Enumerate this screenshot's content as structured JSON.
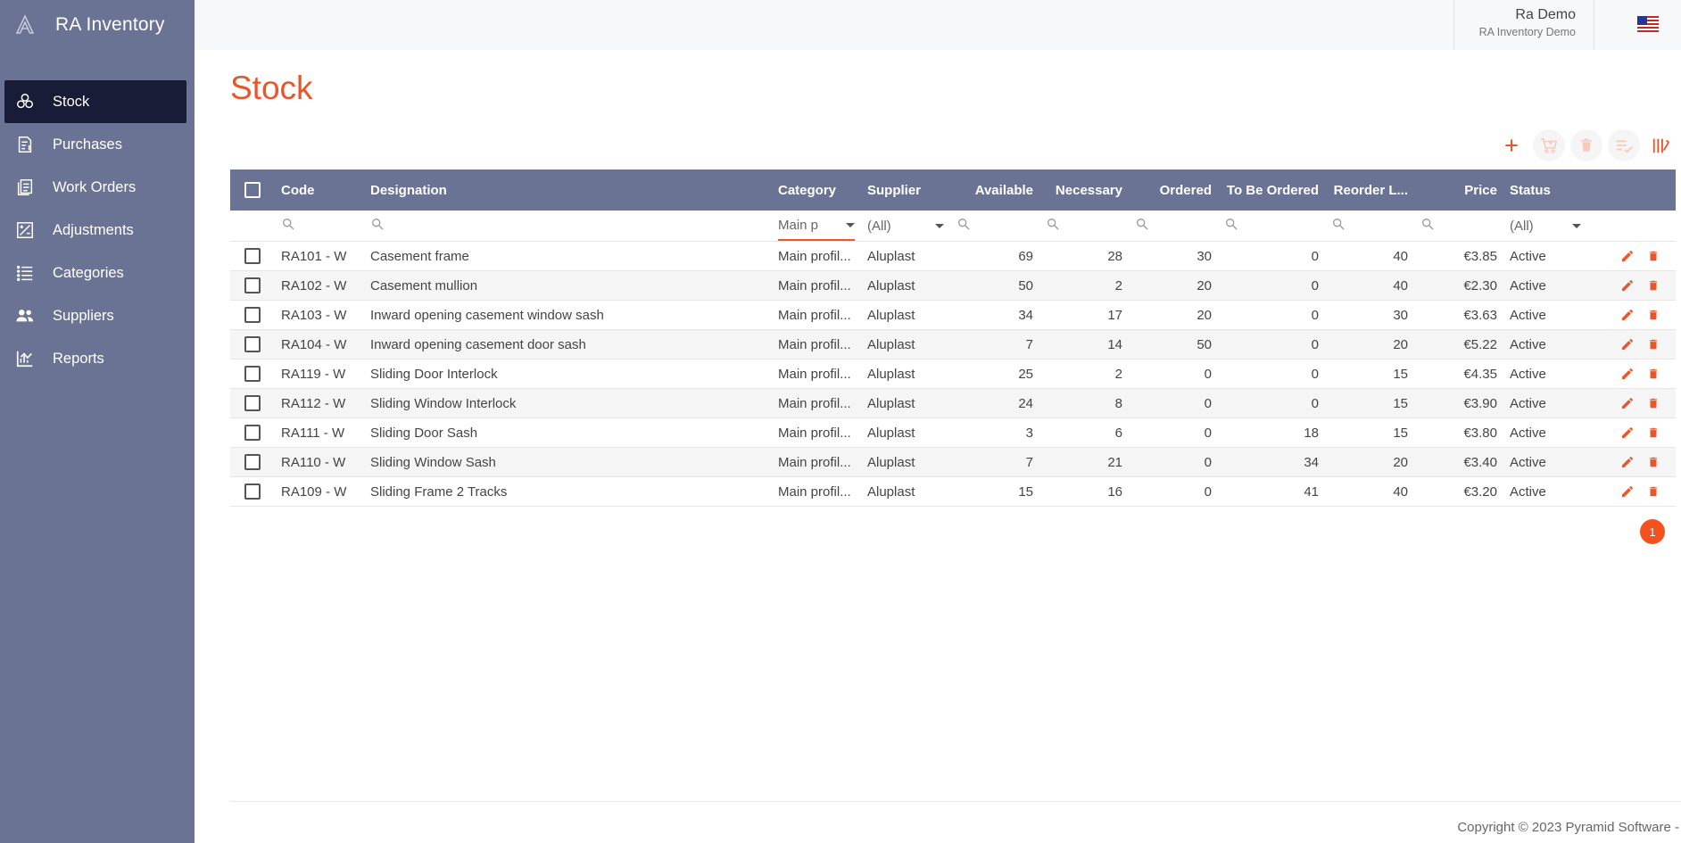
{
  "app": {
    "title": "RA Inventory"
  },
  "sidebar": {
    "items": [
      {
        "label": "Stock",
        "icon": "stock-icon",
        "active": true
      },
      {
        "label": "Purchases",
        "icon": "purchases-icon"
      },
      {
        "label": "Work Orders",
        "icon": "work-orders-icon"
      },
      {
        "label": "Adjustments",
        "icon": "adjustments-icon"
      },
      {
        "label": "Categories",
        "icon": "categories-icon"
      },
      {
        "label": "Suppliers",
        "icon": "suppliers-icon"
      },
      {
        "label": "Reports",
        "icon": "reports-icon"
      }
    ]
  },
  "header": {
    "user_name": "Ra Demo",
    "user_org": "RA Inventory Demo",
    "flag_icon": "us-flag-icon"
  },
  "page": {
    "title": "Stock"
  },
  "colors": {
    "accent": "#e8562a",
    "sidebar": "#6b7394",
    "sidebar_active": "#181c36"
  },
  "table": {
    "columns": {
      "code": "Code",
      "designation": "Designation",
      "category": "Category",
      "supplier": "Supplier",
      "available": "Available",
      "necessary": "Necessary",
      "ordered": "Ordered",
      "to_be_ordered": "To Be Ordered",
      "reorder_level": "Reorder L...",
      "price": "Price",
      "status": "Status"
    },
    "filters": {
      "category": "Main p",
      "supplier": "(All)",
      "status": "(All)"
    },
    "rows": [
      {
        "code": "RA101 - W",
        "designation": "Casement frame",
        "category": "Main profil...",
        "supplier": "Aluplast",
        "available": "69",
        "necessary": "28",
        "ordered": "30",
        "to_be_ordered": "0",
        "reorder_level": "40",
        "price": "€3.85",
        "status": "Active"
      },
      {
        "code": "RA102 - W",
        "designation": "Casement mullion",
        "category": "Main profil...",
        "supplier": "Aluplast",
        "available": "50",
        "necessary": "2",
        "ordered": "20",
        "to_be_ordered": "0",
        "reorder_level": "40",
        "price": "€2.30",
        "status": "Active"
      },
      {
        "code": "RA103 - W",
        "designation": "Inward opening casement window sash",
        "category": "Main profil...",
        "supplier": "Aluplast",
        "available": "34",
        "necessary": "17",
        "ordered": "20",
        "to_be_ordered": "0",
        "reorder_level": "30",
        "price": "€3.63",
        "status": "Active"
      },
      {
        "code": "RA104 - W",
        "designation": "Inward opening casement door sash",
        "category": "Main profil...",
        "supplier": "Aluplast",
        "available": "7",
        "necessary": "14",
        "ordered": "50",
        "to_be_ordered": "0",
        "reorder_level": "20",
        "price": "€5.22",
        "status": "Active"
      },
      {
        "code": "RA119 - W",
        "designation": "Sliding Door Interlock",
        "category": "Main profil...",
        "supplier": "Aluplast",
        "available": "25",
        "necessary": "2",
        "ordered": "0",
        "to_be_ordered": "0",
        "reorder_level": "15",
        "price": "€4.35",
        "status": "Active"
      },
      {
        "code": "RA112 - W",
        "designation": "Sliding Window Interlock",
        "category": "Main profil...",
        "supplier": "Aluplast",
        "available": "24",
        "necessary": "8",
        "ordered": "0",
        "to_be_ordered": "0",
        "reorder_level": "15",
        "price": "€3.90",
        "status": "Active"
      },
      {
        "code": "RA111 - W",
        "designation": "Sliding Door Sash",
        "category": "Main profil...",
        "supplier": "Aluplast",
        "available": "3",
        "necessary": "6",
        "ordered": "0",
        "to_be_ordered": "18",
        "reorder_level": "15",
        "price": "€3.80",
        "status": "Active"
      },
      {
        "code": "RA110 - W",
        "designation": "Sliding Window Sash",
        "category": "Main profil...",
        "supplier": "Aluplast",
        "available": "7",
        "necessary": "21",
        "ordered": "0",
        "to_be_ordered": "34",
        "reorder_level": "20",
        "price": "€3.40",
        "status": "Active"
      },
      {
        "code": "RA109 - W",
        "designation": "Sliding Frame 2 Tracks",
        "category": "Main profil...",
        "supplier": "Aluplast",
        "available": "15",
        "necessary": "16",
        "ordered": "0",
        "to_be_ordered": "41",
        "reorder_level": "40",
        "price": "€3.20",
        "status": "Active"
      }
    ]
  },
  "pager": {
    "current": "1"
  },
  "footer": {
    "copyright": "Copyright © 2023 Pyramid Software -"
  }
}
